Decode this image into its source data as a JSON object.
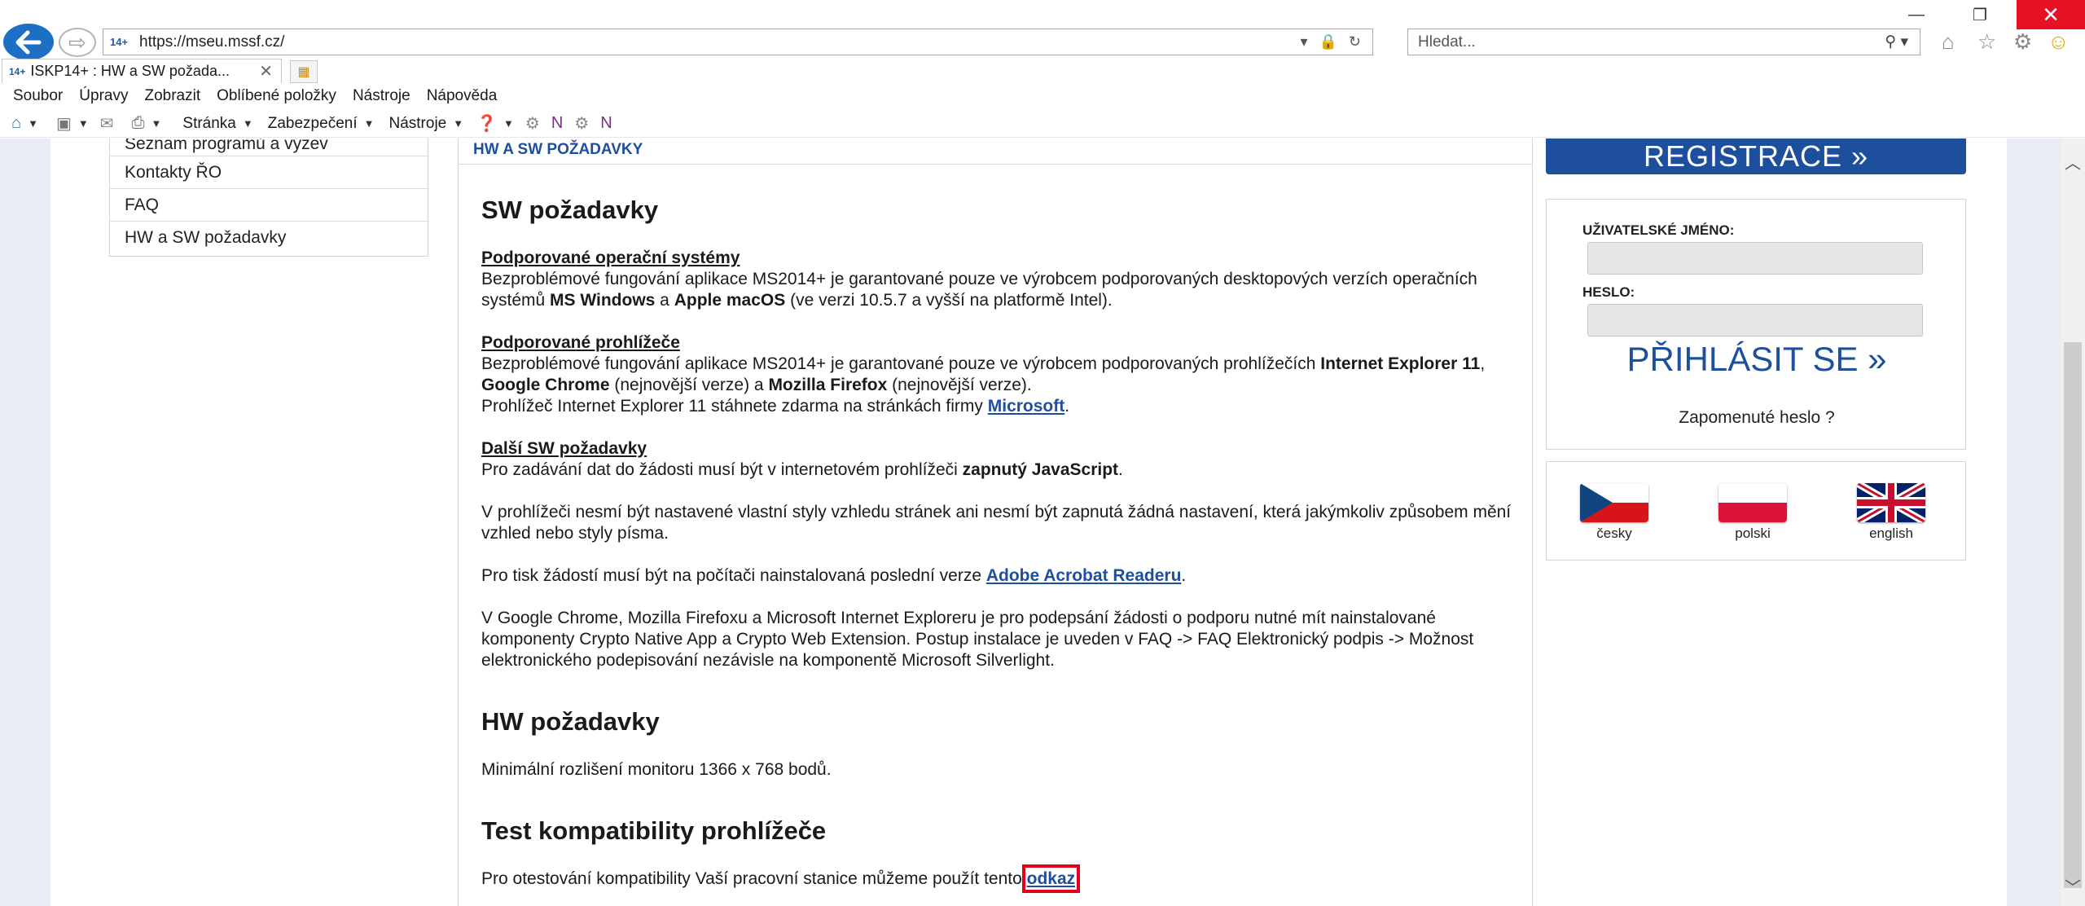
{
  "browser": {
    "url": "https://mseu.mssf.cz/",
    "url_favicon": "14+",
    "search_placeholder": "Hledat...",
    "tab_title": "ISKP14+ : HW a SW požada...",
    "tab_favicon": "14+",
    "menu": [
      "Soubor",
      "Úpravy",
      "Zobrazit",
      "Oblíbené položky",
      "Nástroje",
      "Nápověda"
    ],
    "commands": {
      "page": "Stránka",
      "security": "Zabezpečení",
      "tools": "Nástroje"
    }
  },
  "sidebar": {
    "items": [
      "Seznam programů a výzev",
      "Kontakty ŘO",
      "FAQ",
      "HW a SW požadavky"
    ]
  },
  "main": {
    "breadcrumb": "HW A SW POŽADAVKY",
    "sw_heading": "SW požadavky",
    "os_title": "Podporované operační systémy",
    "os_text_1": "Bezproblémové fungování aplikace MS2014+ je garantované pouze ve výrobcem podporovaných desktopových verzích operačních systémů ",
    "os_win": "MS Windows",
    "os_and": " a ",
    "os_mac": "Apple macOS",
    "os_text_2": " (ve verzi 10.5.7 a vyšší na platformě Intel).",
    "br_title": "Podporované prohlížeče",
    "br_text_1": "Bezproblémové fungování aplikace MS2014+ je garantované pouze ve výrobcem podporovaných prohlížečích ",
    "br_ie": "Internet Explorer 11",
    "br_comma": ", ",
    "br_chrome": "Google Chrome",
    "br_text_2": " (nejnovější verze) a ",
    "br_ff": "Mozilla Firefox",
    "br_text_3": " (nejnovější verze).",
    "br_text_4": "Prohlížeč Internet Explorer 11 stáhnete zdarma na stránkách firmy ",
    "br_link": "Microsoft",
    "other_title": "Další SW požadavky",
    "other_text_1": "Pro zadávání dat do žádosti musí být v internetovém prohlížeči ",
    "other_js": "zapnutý JavaScript",
    "other_text_2": "V prohlížeči nesmí být nastavené vlastní styly vzhledu stránek ani nesmí být zapnutá žádná nastavení, která jakýmkoliv způsobem mění vzhled nebo styly písma.",
    "other_text_3": "Pro tisk žádostí musí být na počítači nainstalovaná poslední verze ",
    "other_link": "Adobe Acrobat Readeru",
    "other_text_4": "V Google Chrome, Mozilla Firefoxu a Microsoft Internet Exploreru je pro podepsání žádosti o podporu nutné mít nainstalované komponenty Crypto Native App a Crypto Web Extension. Postup instalace je uveden v FAQ -> FAQ Elektronický podpis -> Možnost elektronického podepisování nezávisle na komponentě Microsoft Silverlight.",
    "hw_heading": "HW požadavky",
    "hw_text": "Minimální rozlišení monitoru 1366 x 768 bodů.",
    "test_heading": "Test kompatibility prohlížeče",
    "test_text": "Pro otestování kompatibility Vaší pracovní stanice můžeme použít tento ",
    "test_link": "odkaz",
    "period": "."
  },
  "login": {
    "register": "REGISTRACE »",
    "username_label": "UŽIVATELSKÉ JMÉNO:",
    "password_label": "HESLO:",
    "login_button": "PŘIHLÁSIT SE »",
    "forgot": "Zapomenuté heslo ?"
  },
  "languages": [
    {
      "label": "česky",
      "icon": "czech-flag-icon"
    },
    {
      "label": "polski",
      "icon": "polish-flag-icon"
    },
    {
      "label": "english",
      "icon": "uk-flag-icon"
    }
  ],
  "colors": {
    "accent": "#1e4f9c",
    "highlight": "#e0001a",
    "close": "#e81123"
  }
}
